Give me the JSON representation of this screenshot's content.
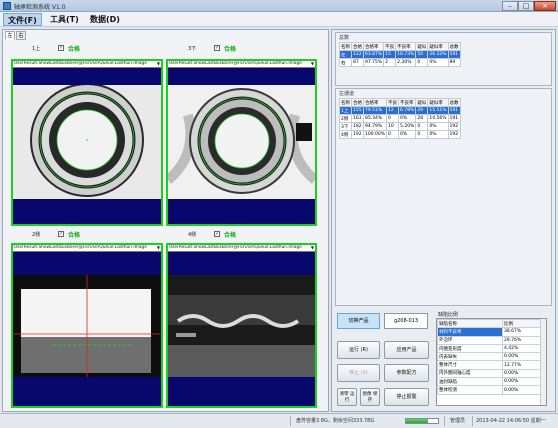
{
  "window": {
    "title": "轴承检测系统 V1.0",
    "min": "–",
    "max": "□",
    "close": "×"
  },
  "menu": [
    {
      "label": "文件(F)"
    },
    {
      "label": "工具(T)"
    },
    {
      "label": "数据(D)"
    }
  ],
  "tabs": [
    "左",
    "右"
  ],
  "cameras": [
    {
      "label": "1上",
      "checked": "✓",
      "status": "合格",
      "combo": "UserResult.ShowLastBusBorer@ForUserQueue.LastRun.Image"
    },
    {
      "label": "3下",
      "checked": "✓",
      "status": "合格",
      "combo": "UserResult.ShowLastBusBorer@ForUserQueue.LastRun.Image"
    },
    {
      "label": "2侧",
      "checked": "✓",
      "status": "合格",
      "combo": "UserResult.ShowLastBusBorer@ForUserQueue.LastRun.Image"
    },
    {
      "label": "4侧",
      "checked": "✓",
      "status": "合格",
      "combo": "UserResult.ShowLastBusBorer@ForUserQueue.LastRun.Image"
    }
  ],
  "summary": {
    "title": "总数",
    "headers": [
      "名称",
      "合格",
      "合格率",
      "不良",
      "不良率",
      "疑似",
      "疑似率",
      "总数"
    ],
    "rows": [
      [
        "左",
        "122",
        "63.87%",
        "15",
        "10.73%",
        "50",
        "26.32%",
        "191"
      ],
      [
        "右",
        "87",
        "97.75%",
        "2",
        "2.30%",
        "0",
        "0%",
        "89"
      ]
    ]
  },
  "channels": {
    "title": "左通道",
    "headers": [
      "名称",
      "合格",
      "合格率",
      "不良",
      "不良率",
      "疑似",
      "疑似率",
      "总数"
    ],
    "rows": [
      [
        "1上",
        "155",
        "79.51%",
        "12",
        "6.78%",
        "29",
        "15.51%",
        "191"
      ],
      [
        "2侧",
        "163",
        "85.34%",
        "0",
        "0%",
        "28",
        "14.56%",
        "191"
      ],
      [
        "3下",
        "182",
        "94.79%",
        "10",
        "5.20%",
        "0",
        "0%",
        "192"
      ],
      [
        "4侧",
        "192",
        "100.00%",
        "0",
        "0%",
        "0",
        "0%",
        "192"
      ]
    ]
  },
  "controls": {
    "switch_product": "切换产品",
    "model": "g208-013",
    "run": "运行 (R)",
    "stop": "停止 (S)",
    "reset": "清零 运行",
    "save": "图像 保存",
    "settings": "应用产品",
    "params": "参数配方",
    "stop_alarm": "停止报警"
  },
  "defects": {
    "title": "缺陷比例",
    "headers": [
      "缺陷名称",
      "比例"
    ],
    "rows": [
      [
        "材料不良率",
        "38.67%"
      ],
      [
        "外沿环",
        "29.76%"
      ],
      [
        "内圈变形度",
        "4.42%"
      ],
      [
        "内表缺失",
        "0.00%"
      ],
      [
        "整体尺寸",
        "12.77%"
      ],
      [
        "内外圈同轴心度",
        "0.00%"
      ],
      [
        "油封缺陷",
        "0.00%"
      ],
      [
        "整体检测",
        "0.00%"
      ]
    ]
  },
  "status": {
    "disk": "盘符容量3.8G，剩余空间333.78G",
    "progress": 0.7,
    "user": "管理员",
    "datetime": "2013-04-22 14:06:50 星期一"
  },
  "colors": {
    "accent_green": "#1fcf1f",
    "ok_text": "#12b312",
    "navy_band": "#07076e",
    "selection": "#2a6fd1"
  }
}
